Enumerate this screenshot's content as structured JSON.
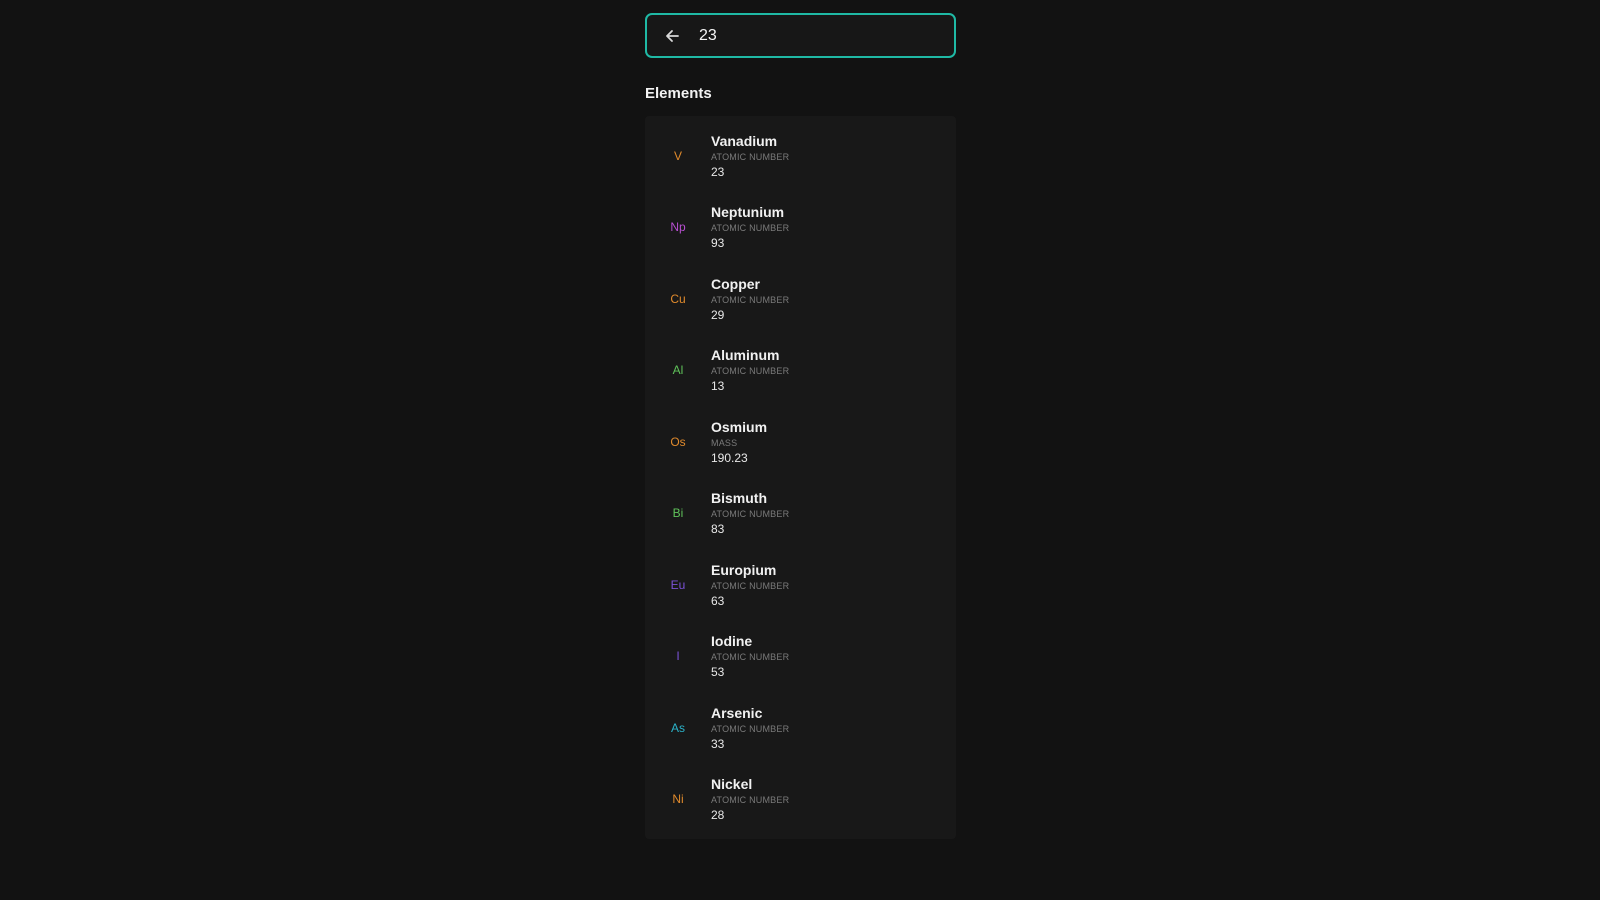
{
  "search": {
    "value": "23"
  },
  "section_title": "Elements",
  "elements": [
    {
      "symbol": "V",
      "name": "Vanadium",
      "label": "ATOMIC NUMBER",
      "value": "23",
      "color": "#e08a2c"
    },
    {
      "symbol": "Np",
      "name": "Neptunium",
      "label": "ATOMIC NUMBER",
      "value": "93",
      "color": "#b84fd1"
    },
    {
      "symbol": "Cu",
      "name": "Copper",
      "label": "ATOMIC NUMBER",
      "value": "29",
      "color": "#e08a2c"
    },
    {
      "symbol": "Al",
      "name": "Aluminum",
      "label": "ATOMIC NUMBER",
      "value": "13",
      "color": "#5fc25a"
    },
    {
      "symbol": "Os",
      "name": "Osmium",
      "label": "MASS",
      "value": "190.23",
      "color": "#e08a2c"
    },
    {
      "symbol": "Bi",
      "name": "Bismuth",
      "label": "ATOMIC NUMBER",
      "value": "83",
      "color": "#5fc25a"
    },
    {
      "symbol": "Eu",
      "name": "Europium",
      "label": "ATOMIC NUMBER",
      "value": "63",
      "color": "#7a52d6"
    },
    {
      "symbol": "I",
      "name": "Iodine",
      "label": "ATOMIC NUMBER",
      "value": "53",
      "color": "#7a52d6"
    },
    {
      "symbol": "As",
      "name": "Arsenic",
      "label": "ATOMIC NUMBER",
      "value": "33",
      "color": "#2bb3c9"
    },
    {
      "symbol": "Ni",
      "name": "Nickel",
      "label": "ATOMIC NUMBER",
      "value": "28",
      "color": "#e08a2c"
    }
  ],
  "colors": {
    "accent": "#1fb9a5",
    "background": "#121212"
  },
  "icons": {
    "back": "arrow-left-icon"
  }
}
